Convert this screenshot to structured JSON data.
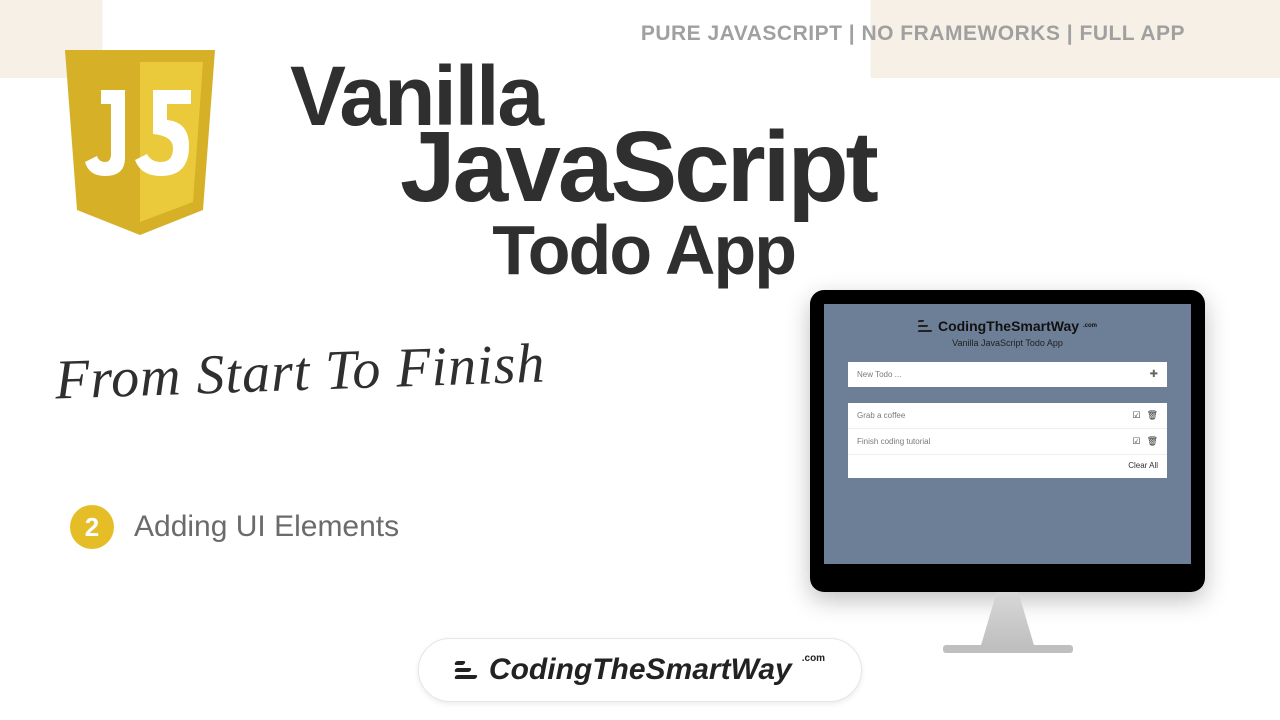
{
  "tagline": "PURE JAVASCRIPT | NO FRAMEWORKS | FULL APP",
  "title": {
    "line1": "Vanilla",
    "line2": "JavaScript",
    "line3": "Todo App"
  },
  "subtitle": "From Start To Finish",
  "step": {
    "number": "2",
    "label": "Adding UI Elements"
  },
  "brand": {
    "name": "CodingTheSmartWay",
    "tld": ".com"
  },
  "monitor": {
    "brand": "CodingTheSmartWay",
    "brand_tld": ".com",
    "app_title": "Vanilla JavaScript Todo App",
    "input_placeholder": "New Todo ...",
    "items": [
      {
        "text": "Grab a coffee"
      },
      {
        "text": "Finish coding tutorial"
      }
    ],
    "clear_label": "Clear All"
  },
  "icons": {
    "add": "✚",
    "check": "☑",
    "trash": "🗑"
  },
  "colors": {
    "accent": "#e5be27",
    "screen_bg": "#6d7f96",
    "text_dark": "#2f2f2f"
  }
}
